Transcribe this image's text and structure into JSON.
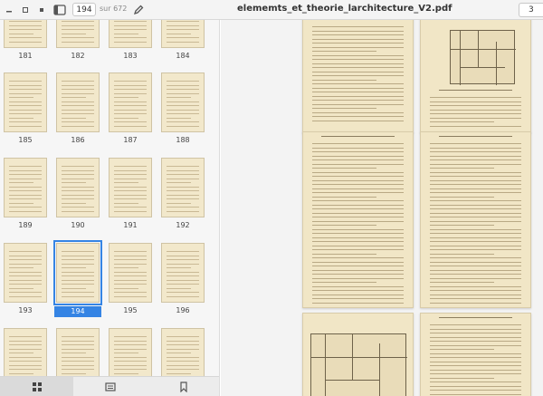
{
  "header": {
    "page_number": "194",
    "page_count": "sur 672",
    "title": "elememts_et_theorie_larchitecture_V2.pdf",
    "zoom_partial": "3"
  },
  "sidebar": {
    "thumbnails": [
      {
        "label": "181"
      },
      {
        "label": "182"
      },
      {
        "label": "183"
      },
      {
        "label": "184"
      },
      {
        "label": "185"
      },
      {
        "label": "186"
      },
      {
        "label": "187"
      },
      {
        "label": "188"
      },
      {
        "label": "189"
      },
      {
        "label": "190"
      },
      {
        "label": "191"
      },
      {
        "label": "192"
      },
      {
        "label": "193"
      },
      {
        "label": "194",
        "selected": true
      },
      {
        "label": "195"
      },
      {
        "label": "196"
      },
      {
        "label": ""
      },
      {
        "label": ""
      },
      {
        "label": ""
      },
      {
        "label": ""
      }
    ],
    "tabs": [
      {
        "icon": "grid-icon",
        "active": true
      },
      {
        "icon": "outline-icon",
        "active": false
      },
      {
        "icon": "bookmark-icon",
        "active": false
      }
    ]
  },
  "colors": {
    "accent": "#3584e4",
    "paper": "#f2e8cb"
  }
}
